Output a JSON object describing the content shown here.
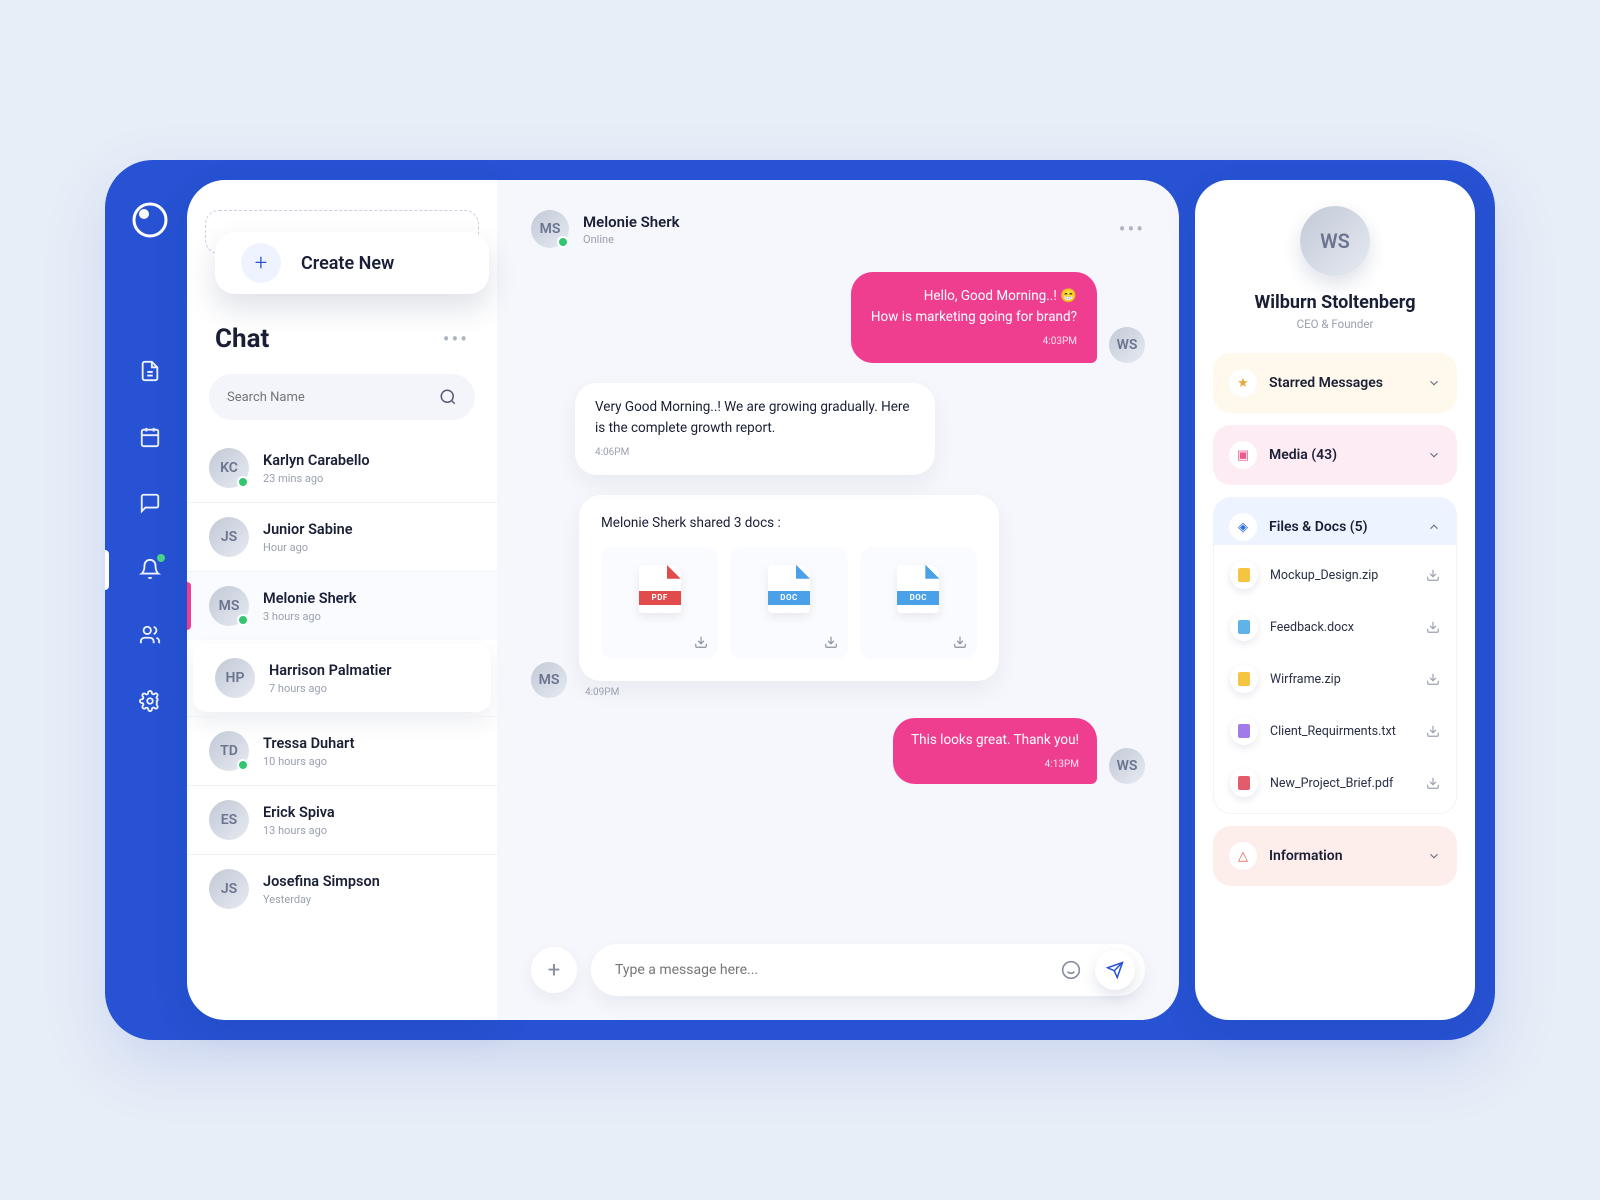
{
  "nav": {
    "items": [
      "document",
      "calendar",
      "chat",
      "bell",
      "people",
      "settings"
    ],
    "active_index": 2
  },
  "sidebar": {
    "create_label": "Create New",
    "title": "Chat",
    "search_placeholder": "Search Name",
    "contacts": [
      {
        "name": "Karlyn Carabello",
        "time": "23 mins ago",
        "online": true
      },
      {
        "name": "Junior Sabine",
        "time": "Hour ago",
        "online": false
      },
      {
        "name": "Melonie Sherk",
        "time": "3 hours ago",
        "online": true,
        "active": true
      },
      {
        "name": "Harrison Palmatier",
        "time": "7 hours ago",
        "online": false,
        "raised": true
      },
      {
        "name": "Tressa Duhart",
        "time": "10 hours ago",
        "online": true
      },
      {
        "name": "Erick Spiva",
        "time": "13 hours ago",
        "online": false
      },
      {
        "name": "Josefina Simpson",
        "time": "Yesterday",
        "online": false
      }
    ]
  },
  "conversation": {
    "name": "Melonie Sherk",
    "status": "Online",
    "m1_line1": "Hello, Good Morning..! 😁",
    "m1_line2": "How is marketing going for brand?",
    "m1_time": "4:03PM",
    "m2_text": "Very Good Morning..! We are growing gradually. Here is the complete growth report.",
    "m2_time": "4:06PM",
    "share_title": "Melonie Sherk shared 3 docs :",
    "docs": [
      {
        "label": "PDF",
        "color": "#e24b4b"
      },
      {
        "label": "DOC",
        "color": "#4aa1e8"
      },
      {
        "label": "DOC",
        "color": "#4aa1e8"
      }
    ],
    "share_time": "4:09PM",
    "m3_text": "This looks great. Thank you!",
    "m3_time": "4:13PM",
    "input_placeholder": "Type a message here..."
  },
  "info": {
    "name": "Wilburn Stoltenberg",
    "role": "CEO & Founder",
    "starred_label": "Starred Messages",
    "media_label": "Media (43)",
    "files_label": "Files & Docs (5)",
    "info_label": "Information",
    "files": [
      {
        "name": "Mockup_Design.zip",
        "color": "#f5c542"
      },
      {
        "name": "Feedback.docx",
        "color": "#5fb3e8"
      },
      {
        "name": "Wirframe.zip",
        "color": "#f5c542"
      },
      {
        "name": "Client_Requirments.txt",
        "color": "#a37be8"
      },
      {
        "name": "New_Project_Brief.pdf",
        "color": "#e45b6b"
      }
    ]
  },
  "colors": {
    "primary": "#2652d3",
    "accent": "#ef3d90"
  }
}
